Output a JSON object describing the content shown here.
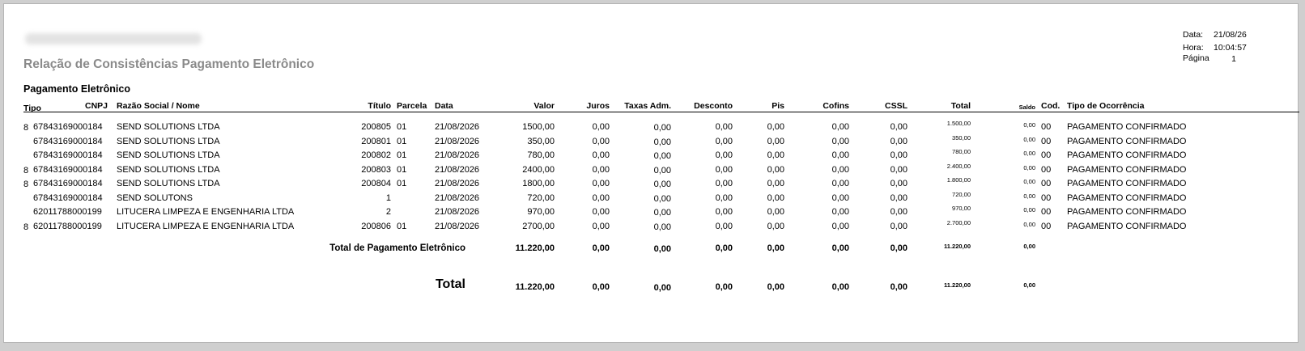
{
  "report": {
    "title": "Relação de Consistências Pagamento Eletrônico",
    "section_title": "Pagamento Eletrônico",
    "date_label": "Data:",
    "date_value": "21/08/26",
    "time_label": "Hora:",
    "time_value": "10:04:57",
    "page_label": "Página",
    "page_value": "1"
  },
  "columns": {
    "tipo": "Tipo",
    "cnpj": "CNPJ",
    "razao": "Razão Social / Nome",
    "titulo": "Título",
    "parcela": "Parcela",
    "data": "Data",
    "valor": "Valor",
    "juros": "Juros",
    "taxas": "Taxas Adm.",
    "desconto": "Desconto",
    "pis": "Pis",
    "cofins": "Cofins",
    "cssl": "CSSL",
    "total": "Total",
    "saldo": "Saldo",
    "cod": "Cod.",
    "ocorrencia": "Tipo de Ocorrência"
  },
  "rows": [
    {
      "tipo": "8",
      "cnpj": "67843169000184",
      "razao": "SEND SOLUTIONS LTDA",
      "titulo": "200805",
      "parcela": "01",
      "data": "21/08/2026",
      "valor": "1500,00",
      "juros": "0,00",
      "taxas": "0,00",
      "desconto": "0,00",
      "pis": "0,00",
      "cofins": "0,00",
      "cssl": "0,00",
      "total": "1.500,00",
      "saldo": "0,00",
      "cod": "00",
      "ocorrencia": "PAGAMENTO CONFIRMADO"
    },
    {
      "tipo": "",
      "cnpj": "67843169000184",
      "razao": "SEND SOLUTIONS LTDA",
      "titulo": "200801",
      "parcela": "01",
      "data": "21/08/2026",
      "valor": "350,00",
      "juros": "0,00",
      "taxas": "0,00",
      "desconto": "0,00",
      "pis": "0,00",
      "cofins": "0,00",
      "cssl": "0,00",
      "total": "350,00",
      "saldo": "0,00",
      "cod": "00",
      "ocorrencia": "PAGAMENTO CONFIRMADO"
    },
    {
      "tipo": "",
      "cnpj": "67843169000184",
      "razao": "SEND SOLUTIONS LTDA",
      "titulo": "200802",
      "parcela": "01",
      "data": "21/08/2026",
      "valor": "780,00",
      "juros": "0,00",
      "taxas": "0,00",
      "desconto": "0,00",
      "pis": "0,00",
      "cofins": "0,00",
      "cssl": "0,00",
      "total": "780,00",
      "saldo": "0,00",
      "cod": "00",
      "ocorrencia": "PAGAMENTO CONFIRMADO"
    },
    {
      "tipo": "8",
      "cnpj": "67843169000184",
      "razao": "SEND SOLUTIONS LTDA",
      "titulo": "200803",
      "parcela": "01",
      "data": "21/08/2026",
      "valor": "2400,00",
      "juros": "0,00",
      "taxas": "0,00",
      "desconto": "0,00",
      "pis": "0,00",
      "cofins": "0,00",
      "cssl": "0,00",
      "total": "2.400,00",
      "saldo": "0,00",
      "cod": "00",
      "ocorrencia": "PAGAMENTO CONFIRMADO"
    },
    {
      "tipo": "8",
      "cnpj": "67843169000184",
      "razao": "SEND SOLUTIONS LTDA",
      "titulo": "200804",
      "parcela": "01",
      "data": "21/08/2026",
      "valor": "1800,00",
      "juros": "0,00",
      "taxas": "0,00",
      "desconto": "0,00",
      "pis": "0,00",
      "cofins": "0,00",
      "cssl": "0,00",
      "total": "1.800,00",
      "saldo": "0,00",
      "cod": "00",
      "ocorrencia": "PAGAMENTO CONFIRMADO"
    },
    {
      "tipo": "",
      "cnpj": "67843169000184",
      "razao": "SEND SOLUTONS",
      "titulo": "1",
      "parcela": "",
      "data": "21/08/2026",
      "valor": "720,00",
      "juros": "0,00",
      "taxas": "0,00",
      "desconto": "0,00",
      "pis": "0,00",
      "cofins": "0,00",
      "cssl": "0,00",
      "total": "720,00",
      "saldo": "0,00",
      "cod": "00",
      "ocorrencia": "PAGAMENTO CONFIRMADO"
    },
    {
      "tipo": "",
      "cnpj": "62011788000199",
      "razao": "LITUCERA LIMPEZA E ENGENHARIA LTDA",
      "titulo": "2",
      "parcela": "",
      "data": "21/08/2026",
      "valor": "970,00",
      "juros": "0,00",
      "taxas": "0,00",
      "desconto": "0,00",
      "pis": "0,00",
      "cofins": "0,00",
      "cssl": "0,00",
      "total": "970,00",
      "saldo": "0,00",
      "cod": "00",
      "ocorrencia": "PAGAMENTO CONFIRMADO"
    },
    {
      "tipo": "8",
      "cnpj": "62011788000199",
      "razao": "LITUCERA LIMPEZA E ENGENHARIA LTDA",
      "titulo": "200806",
      "parcela": "01",
      "data": "21/08/2026",
      "valor": "2700,00",
      "juros": "0,00",
      "taxas": "0,00",
      "desconto": "0,00",
      "pis": "0,00",
      "cofins": "0,00",
      "cssl": "0,00",
      "total": "2.700,00",
      "saldo": "0,00",
      "cod": "00",
      "ocorrencia": "PAGAMENTO CONFIRMADO"
    }
  ],
  "subtotal": {
    "label": "Total de Pagamento Eletrônico",
    "valor": "11.220,00",
    "juros": "0,00",
    "taxas": "0,00",
    "desconto": "0,00",
    "pis": "0,00",
    "cofins": "0,00",
    "cssl": "0,00",
    "total": "11.220,00",
    "saldo": "0,00"
  },
  "grand_total": {
    "label": "Total",
    "valor": "11.220,00",
    "juros": "0,00",
    "taxas": "0,00",
    "desconto": "0,00",
    "pis": "0,00",
    "cofins": "0,00",
    "cssl": "0,00",
    "total": "11.220,00",
    "saldo": "0,00"
  }
}
